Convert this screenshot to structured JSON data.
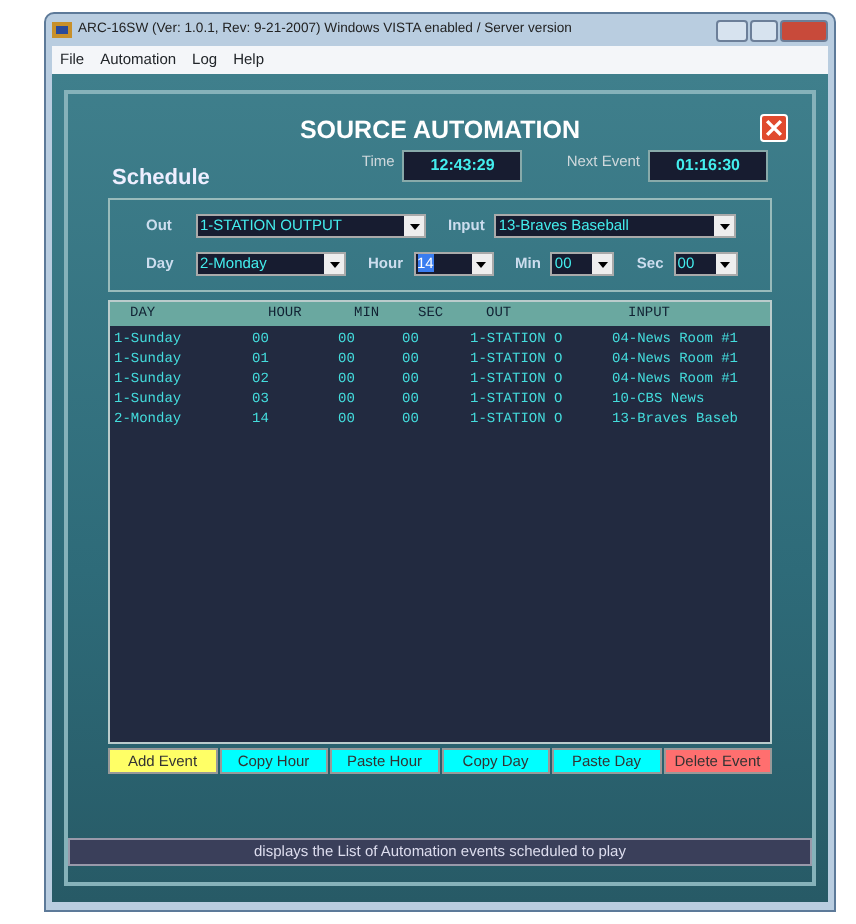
{
  "window": {
    "title": "ARC-16SW  (Ver: 1.0.1, Rev: 9-21-2007)  Windows VISTA enabled / Server version"
  },
  "menu": [
    "File",
    "Automation",
    "Log",
    "Help"
  ],
  "panel": {
    "title": "SOURCE AUTOMATION",
    "heading": "Schedule",
    "time": {
      "label": "Time",
      "value": "12:43:29"
    },
    "next_event": {
      "label": "Next Event",
      "value": "01:16:30"
    },
    "fields": [
      {
        "label": "Out",
        "value": "1-STATION OUTPUT",
        "focused": false
      },
      {
        "label": "Input",
        "value": "13-Braves Baseball",
        "focused": false
      },
      {
        "label": "Day",
        "value": "2-Monday",
        "focused": false
      },
      {
        "label": "Hour",
        "value": "14",
        "focused": true
      },
      {
        "label": "Min",
        "value": "00",
        "focused": false
      },
      {
        "label": "Sec",
        "value": "00",
        "focused": false
      }
    ],
    "table": {
      "columns": [
        "DAY",
        "HOUR",
        "MIN",
        "SEC",
        "OUT",
        "INPUT"
      ],
      "rows": [
        [
          "1-Sunday",
          "00",
          "00",
          "00",
          "1-STATION O",
          "04-News Room #1"
        ],
        [
          "1-Sunday",
          "01",
          "00",
          "00",
          "1-STATION O",
          "04-News Room #1"
        ],
        [
          "1-Sunday",
          "02",
          "00",
          "00",
          "1-STATION O",
          "04-News Room #1"
        ],
        [
          "1-Sunday",
          "03",
          "00",
          "00",
          "1-STATION O",
          "10-CBS News"
        ],
        [
          "2-Monday",
          "14",
          "00",
          "00",
          "1-STATION O",
          "13-Braves Baseb"
        ]
      ]
    },
    "buttons": [
      {
        "label": "Add Event",
        "color": "#ffff66"
      },
      {
        "label": "Copy Hour",
        "color": "#00ffff"
      },
      {
        "label": "Paste Hour",
        "color": "#00ffff"
      },
      {
        "label": "Copy Day",
        "color": "#00ffff"
      },
      {
        "label": "Paste Day",
        "color": "#00ffff"
      },
      {
        "label": "Delete Event",
        "color": "#ff6f6f"
      }
    ]
  },
  "status_bar": "displays the List of Automation events scheduled to play"
}
